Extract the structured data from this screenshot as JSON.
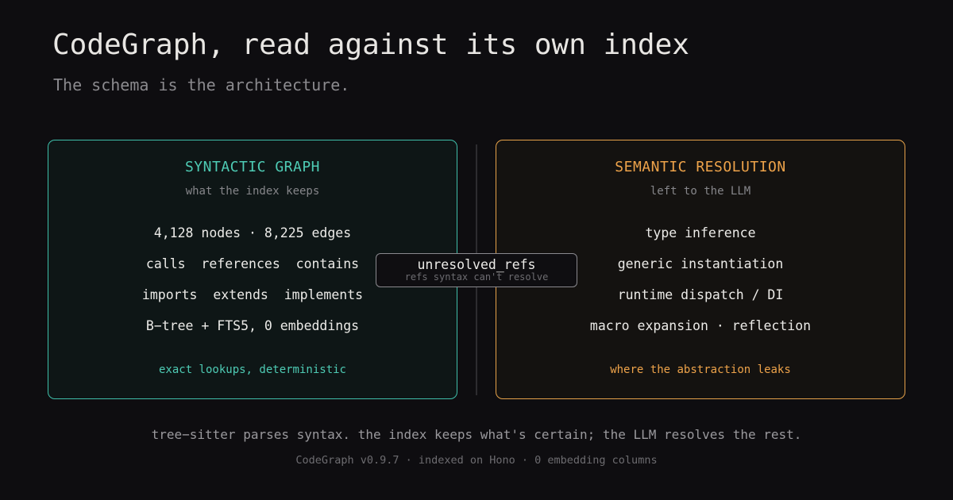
{
  "header": {
    "title": "CodeGraph, read against its own index",
    "subtitle": "The schema is the architecture."
  },
  "left_panel": {
    "title": "SYNTACTIC GRAPH",
    "subtitle": "what the index keeps",
    "items": [
      "4,128 nodes · 8,225 edges",
      "calls  references  contains",
      "imports  extends  implements",
      "B−tree + FTS5, 0 embeddings"
    ],
    "footer": "exact lookups, deterministic",
    "accent_color": "#3fbfaa"
  },
  "right_panel": {
    "title": "SEMANTIC RESOLUTION",
    "subtitle": "left to the LLM",
    "items": [
      "type inference",
      "generic instantiation",
      "runtime dispatch / DI",
      "macro expansion · reflection"
    ],
    "footer": "where the abstraction leaks",
    "accent_color": "#e6a24a"
  },
  "bridge": {
    "label": "unresolved_refs",
    "sublabel": "refs syntax can't resolve"
  },
  "footer": {
    "tagline": "tree−sitter parses syntax. the index keeps what's certain; the LLM resolves the rest.",
    "credit": "CodeGraph v0.9.7 · indexed on Hono · 0 embedding columns"
  }
}
